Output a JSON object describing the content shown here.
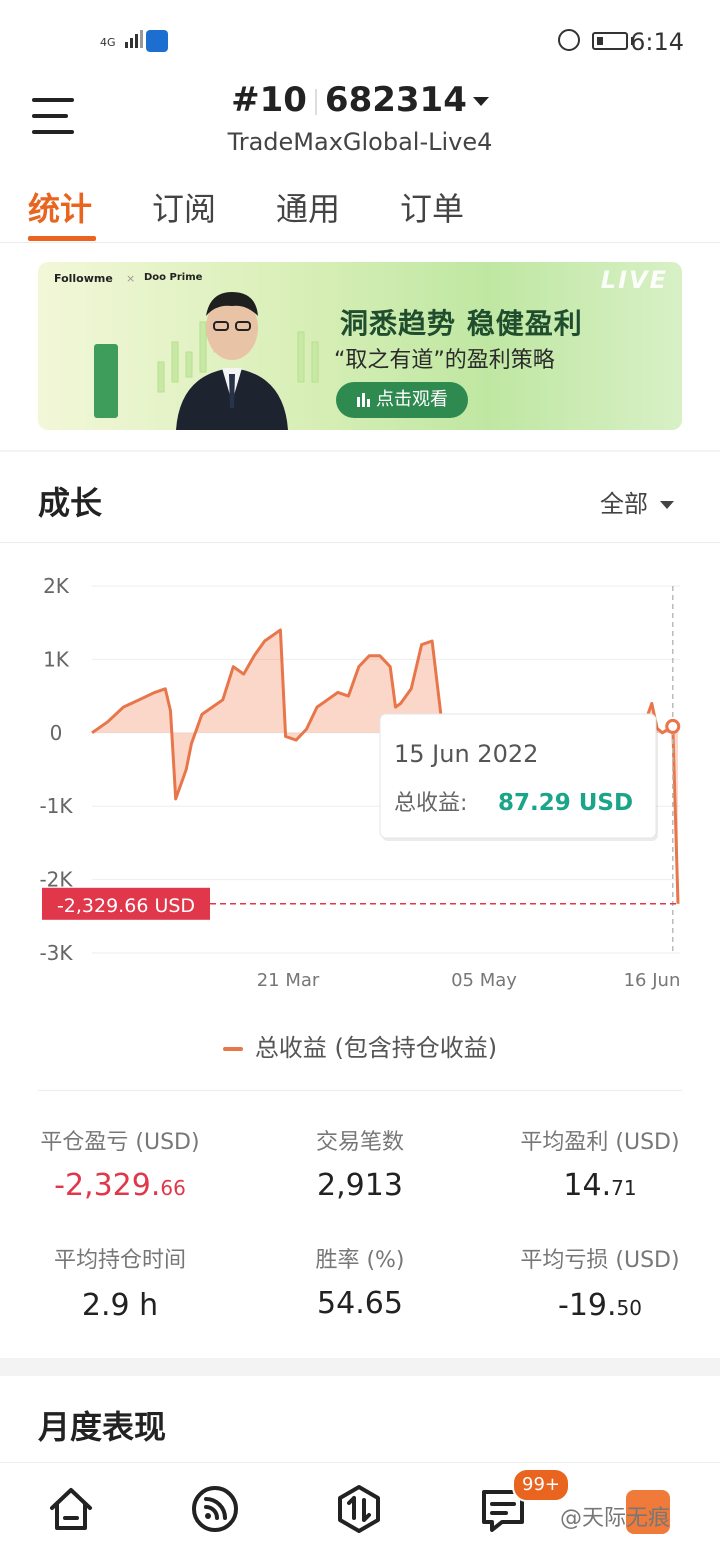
{
  "status_bar": {
    "network": "4G",
    "time": "6:14"
  },
  "header": {
    "account_number": "#10",
    "account_id": "682314",
    "server": "TradeMaxGlobal-Live4"
  },
  "tabs": [
    {
      "label": "统计",
      "active": true
    },
    {
      "label": "订阅",
      "active": false
    },
    {
      "label": "通用",
      "active": false
    },
    {
      "label": "订单",
      "active": false
    }
  ],
  "banner": {
    "logo_left": "Followme",
    "logo_x": "×",
    "logo_right": "Doo Prime",
    "live": "LIVE",
    "headline": "洞悉趋势 稳健盈利",
    "subline": "“取之有道”的盈利策略",
    "button": "点击观看"
  },
  "growth": {
    "title": "成长",
    "filter": "全部"
  },
  "chart_data": {
    "type": "area",
    "y_ticks": [
      "2K",
      "1K",
      "0",
      "-1K",
      "-2K",
      "-3K"
    ],
    "ylim": [
      -3000,
      2000
    ],
    "x_ticks": [
      "21 Mar",
      "05 May",
      "16 Jun"
    ],
    "series": [
      {
        "name": "总收益 (包含持仓收益)",
        "x": [
          "2022-02-24",
          "2022-02-27",
          "2022-03-02",
          "2022-03-05",
          "2022-03-08",
          "2022-03-10",
          "2022-03-11",
          "2022-03-12",
          "2022-03-14",
          "2022-03-15",
          "2022-03-17",
          "2022-03-19",
          "2022-03-21",
          "2022-03-23",
          "2022-03-25",
          "2022-03-27",
          "2022-03-29",
          "2022-03-31",
          "2022-04-01",
          "2022-04-02",
          "2022-04-04",
          "2022-04-06",
          "2022-04-08",
          "2022-04-10",
          "2022-04-12",
          "2022-04-14",
          "2022-04-16",
          "2022-04-18",
          "2022-04-20",
          "2022-04-22",
          "2022-04-23",
          "2022-04-24",
          "2022-04-26",
          "2022-04-28",
          "2022-04-30",
          "2022-05-02",
          "2022-05-03",
          "2022-05-04",
          "2022-05-06",
          "2022-05-07",
          "2022-05-09",
          "2022-05-12",
          "2022-05-16",
          "2022-05-20",
          "2022-05-24",
          "2022-05-28",
          "2022-06-01",
          "2022-06-05",
          "2022-06-08",
          "2022-06-09",
          "2022-06-11",
          "2022-06-12",
          "2022-06-13",
          "2022-06-15",
          "2022-06-16"
        ],
        "values": [
          0,
          150,
          350,
          450,
          550,
          600,
          300,
          -900,
          -500,
          -150,
          250,
          350,
          450,
          900,
          800,
          1050,
          1250,
          1350,
          1400,
          -50,
          -100,
          50,
          350,
          450,
          550,
          500,
          900,
          1050,
          1050,
          900,
          350,
          400,
          600,
          1200,
          1250,
          50,
          30,
          10,
          0,
          0,
          0,
          0,
          0,
          0,
          0,
          0,
          0,
          0,
          0,
          0,
          400,
          60,
          0,
          87.29,
          -2329.66
        ]
      }
    ],
    "markers": {
      "final_value_label": "-2,329.66 USD"
    },
    "tooltip": {
      "date": "15 Jun 2022",
      "label": "总收益:",
      "value": "87.29 USD"
    },
    "grid": true
  },
  "legend": {
    "label": "总收益 (包含持仓收益)"
  },
  "stats": [
    {
      "label": "平仓盈亏 (USD)",
      "int": "-2,329.",
      "dec": "66",
      "negative": true
    },
    {
      "label": "交易笔数",
      "int": "2,913",
      "dec": "",
      "negative": false
    },
    {
      "label": "平均盈利 (USD)",
      "int": "14.",
      "dec": "71",
      "negative": false
    },
    {
      "label": "平均持仓时间",
      "int": "2.9 h",
      "dec": "",
      "negative": false
    },
    {
      "label": "胜率 (%)",
      "int": "54.65",
      "dec": "",
      "negative": false
    },
    {
      "label": "平均亏损 (USD)",
      "int": "-19.",
      "dec": "50",
      "negative": false
    }
  ],
  "monthly": {
    "title": "月度表现"
  },
  "bottom_nav": {
    "badge": "99+",
    "watermark": "@天际无痕"
  },
  "colors": {
    "accent": "#e8641f",
    "negative": "#e0384a",
    "positive": "#1aa58a",
    "area_line": "#e8764a"
  }
}
